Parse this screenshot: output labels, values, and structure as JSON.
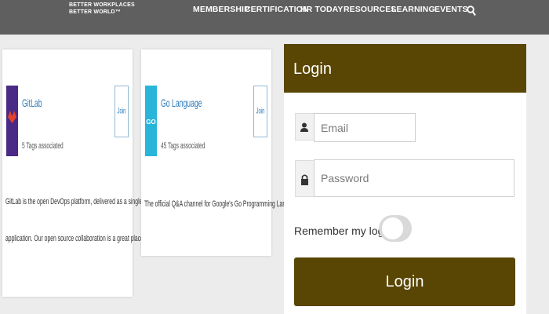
{
  "header": {
    "logo_line1": "BETTER WORKPLACES",
    "logo_line2": "BETTER WORLD™",
    "nav": [
      {
        "label": "MEMBERSHIP"
      },
      {
        "label": "CERTIFICATION"
      },
      {
        "label": "HR TODAY"
      },
      {
        "label": "RESOURCES"
      },
      {
        "label": "LEARNING"
      },
      {
        "label": "EVENTS"
      }
    ],
    "search_icon": "search-icon"
  },
  "cards": [
    {
      "title": "GitLab",
      "subtitle": "5 Tags associated",
      "join_label": "Join",
      "description_line1": "GitLab is the open DevOps platform, delivered as a single",
      "description_line2": "application. Our open source collaboration is a great place to sha...",
      "logo_color": "#4a2a86",
      "logo_accent": "#e2432a"
    },
    {
      "title": "Go Language",
      "subtitle": "45 Tags associated",
      "join_label": "Join",
      "description_line1": "The official Q&A channel for Google's Go Programming Language.",
      "logo_text": "GO",
      "logo_color": "#28b5d9"
    }
  ],
  "login": {
    "title": "Login",
    "email_placeholder": "Email",
    "password_placeholder": "Password",
    "remember_label": "Remember my login",
    "remember_checked": false,
    "button_label": "Login",
    "accent_color": "#5a4604"
  }
}
